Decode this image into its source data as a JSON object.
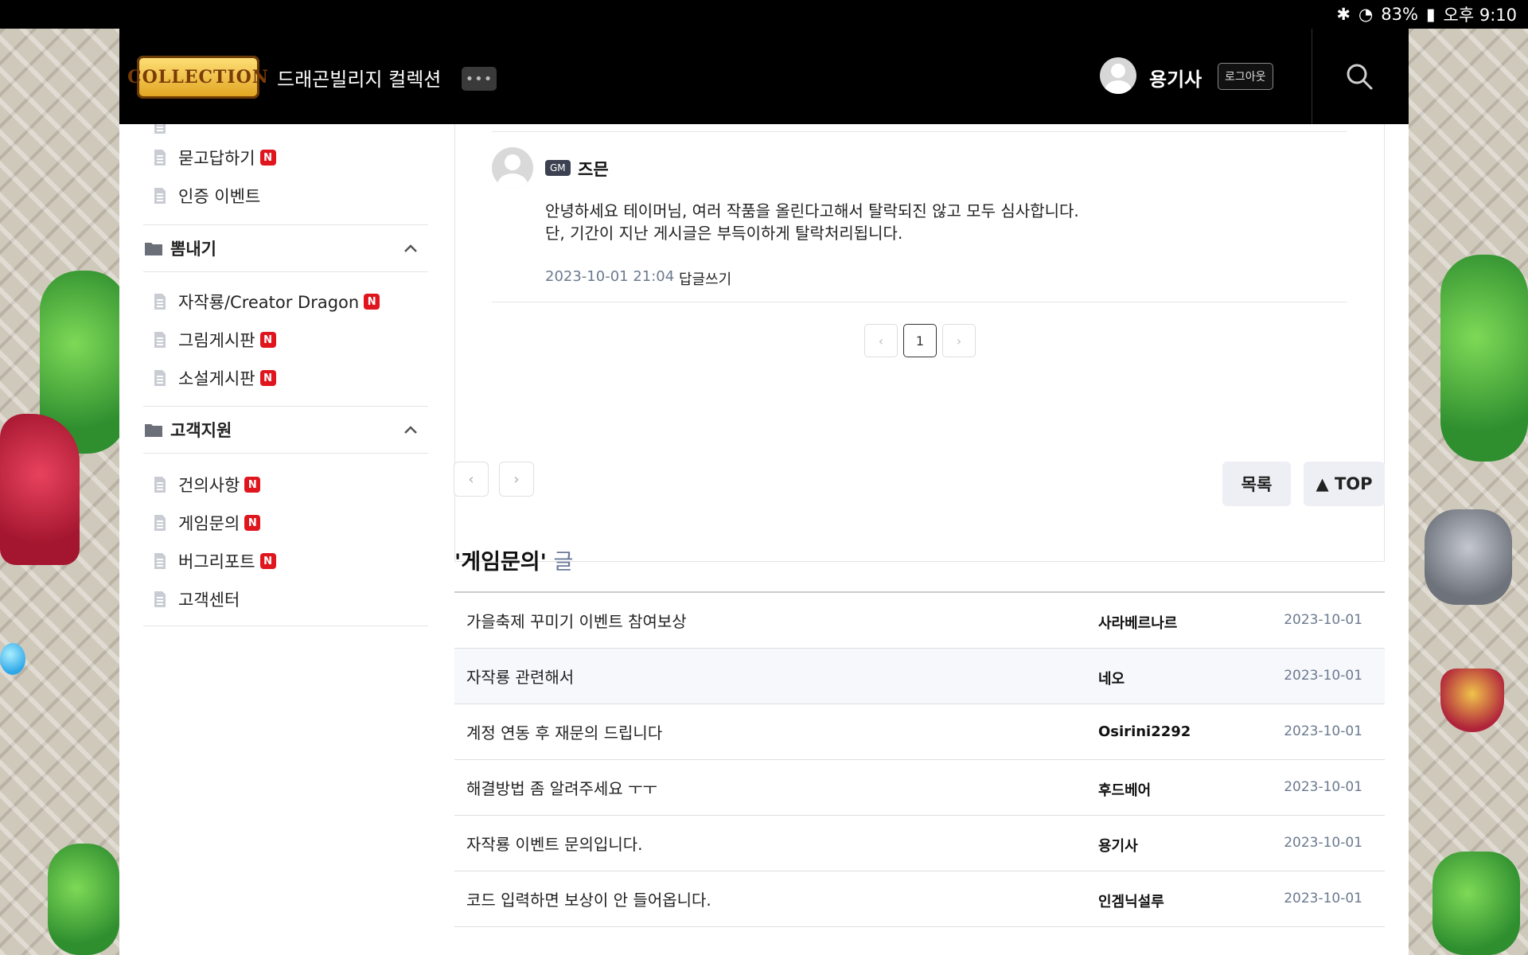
{
  "status_bar": {
    "battery": "83%",
    "time": "오후 9:10"
  },
  "header": {
    "logo_text": "COLLECTION",
    "site_title": "드래곤빌리지 컬렉션",
    "more_label": "•••",
    "username": "용기사",
    "logout_label": "로그아웃"
  },
  "sidebar": {
    "items_top": [
      {
        "label": "묻고답하기",
        "new": "N"
      },
      {
        "label": "인증 이벤트"
      }
    ],
    "groups": [
      {
        "label": "뽐내기",
        "items": [
          {
            "label": "자작룡/Creator Dragon",
            "new": "N"
          },
          {
            "label": "그림게시판",
            "new": "N"
          },
          {
            "label": "소설게시판",
            "new": "N"
          }
        ]
      },
      {
        "label": "고객지원",
        "items": [
          {
            "label": "건의사항",
            "new": "N"
          },
          {
            "label": "게임문의",
            "new": "N"
          },
          {
            "label": "버그리포트",
            "new": "N"
          },
          {
            "label": "고객센터"
          }
        ]
      }
    ]
  },
  "comment": {
    "badge": "GM",
    "author": "즈믄",
    "text": "안녕하세요 테이머님, 여러 작품을 올린다고해서 탈락되진 않고 모두 심사합니다.\n단, 기간이 지난 게시글은 부득이하게 탈락처리됩니다.",
    "date": "2023-10-01 21:04",
    "reply_label": "답글쓰기"
  },
  "pagination": {
    "prev": "‹",
    "current": "1",
    "next": "›"
  },
  "post_nav": {
    "prev": "‹",
    "next": "›",
    "list_label": "목록",
    "top_label": "▲ TOP"
  },
  "related": {
    "title": "'게임문의'",
    "suffix": " 글",
    "posts": [
      {
        "title": "가을축제 꾸미기 이벤트 참여보상",
        "author": "사라베르나르",
        "date": "2023-10-01"
      },
      {
        "title": "자작룡 관련해서",
        "author": "네오",
        "date": "2023-10-01"
      },
      {
        "title": "계정 연동 후 재문의 드립니다",
        "author": "Osirini2292",
        "date": "2023-10-01"
      },
      {
        "title": "해결방법 좀 알려주세요 ㅜㅜ",
        "author": "후드베어",
        "date": "2023-10-01"
      },
      {
        "title": "자작룡 이벤트 문의입니다.",
        "author": "용기사",
        "date": "2023-10-01"
      },
      {
        "title": "코드 입력하면 보상이 안 들어옵니다.",
        "author": "인겜닉설루",
        "date": "2023-10-01"
      }
    ]
  },
  "colors": {
    "accent_new": "#e0161e",
    "date_text": "#6b7a8f",
    "header_bg": "#000000"
  }
}
